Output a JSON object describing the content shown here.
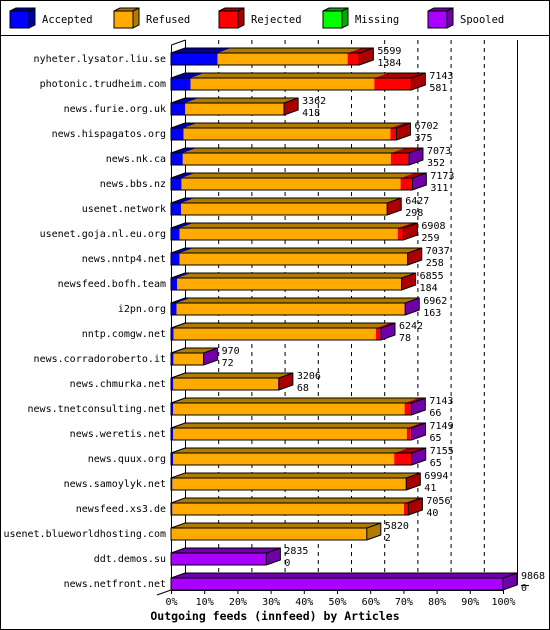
{
  "chart_data": {
    "type": "bar",
    "orientation": "horizontal",
    "stacked": true,
    "style": "3d",
    "title": "Outgoing feeds (innfeed) by Articles",
    "xlabel": "",
    "ylabel": "",
    "xlim": [
      0,
      100
    ],
    "x_unit": "% of maximum articles offered",
    "max_total": 9868,
    "x_tick_labels": [
      "0%",
      "10%",
      "20%",
      "30%",
      "40%",
      "50%",
      "60%",
      "70%",
      "80%",
      "90%",
      "100%"
    ],
    "grid": true,
    "legend_position": "top",
    "legend": [
      {
        "name": "Accepted",
        "color": "#0000FF",
        "side_color": "#0000A0"
      },
      {
        "name": "Refused",
        "color": "#FFAA00",
        "side_color": "#B07C00"
      },
      {
        "name": "Rejected",
        "color": "#FF0000",
        "side_color": "#AA0000"
      },
      {
        "name": "Missing",
        "color": "#00FF00",
        "side_color": "#00AA00"
      },
      {
        "name": "Spooled",
        "color": "#AA00FF",
        "side_color": "#7000A8"
      }
    ],
    "categories": [
      "nyheter.lysator.liu.se",
      "photonic.trudheim.com",
      "news.furie.org.uk",
      "news.hispagatos.org",
      "news.nk.ca",
      "news.bbs.nz",
      "usenet.network",
      "usenet.goja.nl.eu.org",
      "news.nntp4.net",
      "newsfeed.bofh.team",
      "i2pn.org",
      "nntp.comgw.net",
      "news.corradoroberto.it",
      "news.chmurka.net",
      "news.tnetconsulting.net",
      "news.weretis.net",
      "news.quux.org",
      "news.samoylyk.net",
      "newsfeed.xs3.de",
      "usenet.blueworldhosting.com",
      "ddt.demos.su",
      "news.netfront.net"
    ],
    "offered": [
      "5599",
      "7143",
      "3362",
      "6702",
      "7073",
      "7173",
      "6427",
      "6908",
      "7037",
      "6855",
      "6962",
      "6242",
      "970",
      "3206",
      "7143",
      "7149",
      "7155",
      "6994",
      "7056",
      "5820",
      "2835",
      "9868"
    ],
    "accepted": [
      "1384",
      "581",
      "418",
      "375",
      "352",
      "311",
      "298",
      "259",
      "258",
      "184",
      "163",
      "78",
      "72",
      "68",
      "66",
      "65",
      "65",
      "41",
      "40",
      "2",
      "0",
      "0"
    ],
    "series": [
      {
        "name": "Accepted",
        "values": [
          1384,
          581,
          418,
          375,
          352,
          311,
          298,
          259,
          258,
          184,
          163,
          78,
          72,
          68,
          66,
          65,
          65,
          41,
          40,
          2,
          0,
          0
        ]
      },
      {
        "name": "Refused",
        "values": [
          3865,
          5462,
          2924,
          6147,
          6181,
          6512,
          6109,
          6479,
          6759,
          6651,
          6779,
          6014,
          878,
          3118,
          6877,
          6944,
          6570,
          6933,
          6886,
          5818,
          0,
          0
        ]
      },
      {
        "name": "Rejected",
        "values": [
          350,
          1100,
          20,
          180,
          520,
          330,
          20,
          170,
          20,
          20,
          0,
          130,
          0,
          20,
          180,
          120,
          500,
          20,
          130,
          0,
          0,
          0
        ]
      },
      {
        "name": "Missing",
        "values": [
          0,
          0,
          0,
          0,
          0,
          0,
          0,
          0,
          0,
          0,
          0,
          0,
          0,
          0,
          0,
          0,
          0,
          0,
          0,
          0,
          0,
          0
        ]
      },
      {
        "name": "Spooled",
        "values": [
          0,
          0,
          0,
          0,
          20,
          20,
          0,
          0,
          0,
          0,
          20,
          20,
          20,
          0,
          20,
          20,
          20,
          0,
          0,
          0,
          2835,
          9868
        ]
      }
    ]
  }
}
